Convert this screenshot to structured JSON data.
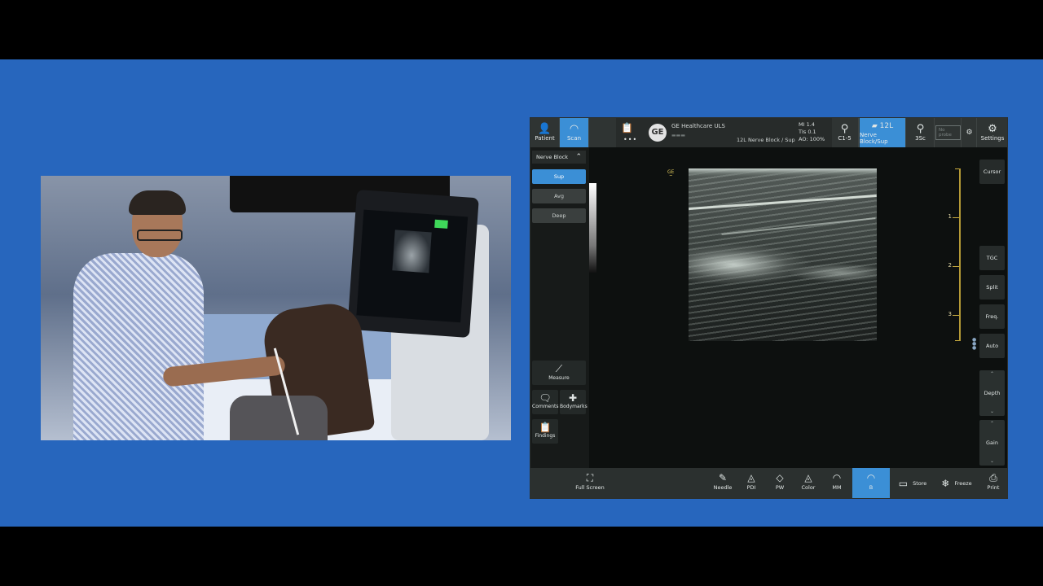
{
  "us": {
    "top": {
      "patient": "Patient",
      "scan": "Scan",
      "company": "GE Healthcare ULS",
      "mode_text": "12L   Nerve Block / Sup",
      "indices": [
        "MI 1.4",
        "TIs 0.1",
        "AO: 100%"
      ],
      "probe1": "C1-5",
      "probe2_num": "12L",
      "probe2": "Nerve Block/Sup",
      "probe3": "3Sc",
      "probe4": "No probe",
      "settings": "Settings"
    },
    "left": {
      "preset": "Nerve Block",
      "buttons": [
        "Sup",
        "Avg",
        "Deep"
      ],
      "measure": "Measure",
      "comments": "Comments",
      "bodymarks": "Bodymarks",
      "findings": "Findings"
    },
    "image": {
      "ge_mark": "GE"
    },
    "ruler": [
      "1",
      "2",
      "3"
    ],
    "right": {
      "cursor": "Cursor",
      "tgc": "TGC",
      "split": "Split",
      "freq": "Freq.",
      "auto": "Auto",
      "depth": "Depth",
      "gain": "Gain"
    },
    "bottom": {
      "fullscreen": "Full Screen",
      "needle": "Needle",
      "pdi": "PDI",
      "pw": "PW",
      "color": "Color",
      "mm": "MM",
      "b": "B",
      "store": "Store",
      "freeze": "Freeze",
      "print": "Print"
    }
  }
}
